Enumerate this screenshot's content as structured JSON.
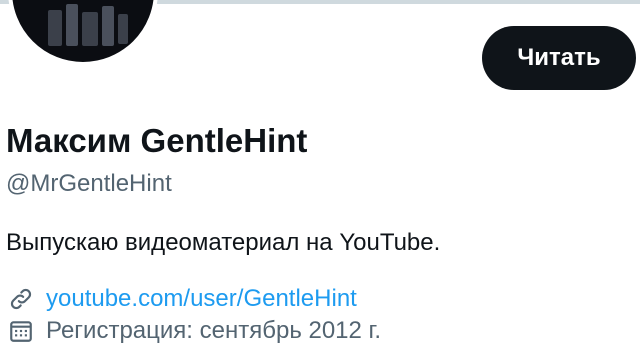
{
  "profile": {
    "display_name": "Максим GentleHint",
    "handle": "@MrGentleHint",
    "bio": "Выпускаю видеоматериал на YouTube.",
    "follow_label": "Читать",
    "website": "youtube.com/user/GentleHint",
    "joined": "Регистрация: сентябрь 2012 г."
  },
  "icons": {
    "link": "link-icon",
    "calendar": "calendar-icon"
  },
  "colors": {
    "accent": "#1d9bf0",
    "text": "#0f1419",
    "muted": "#536471",
    "button_bg": "#0f1419"
  }
}
